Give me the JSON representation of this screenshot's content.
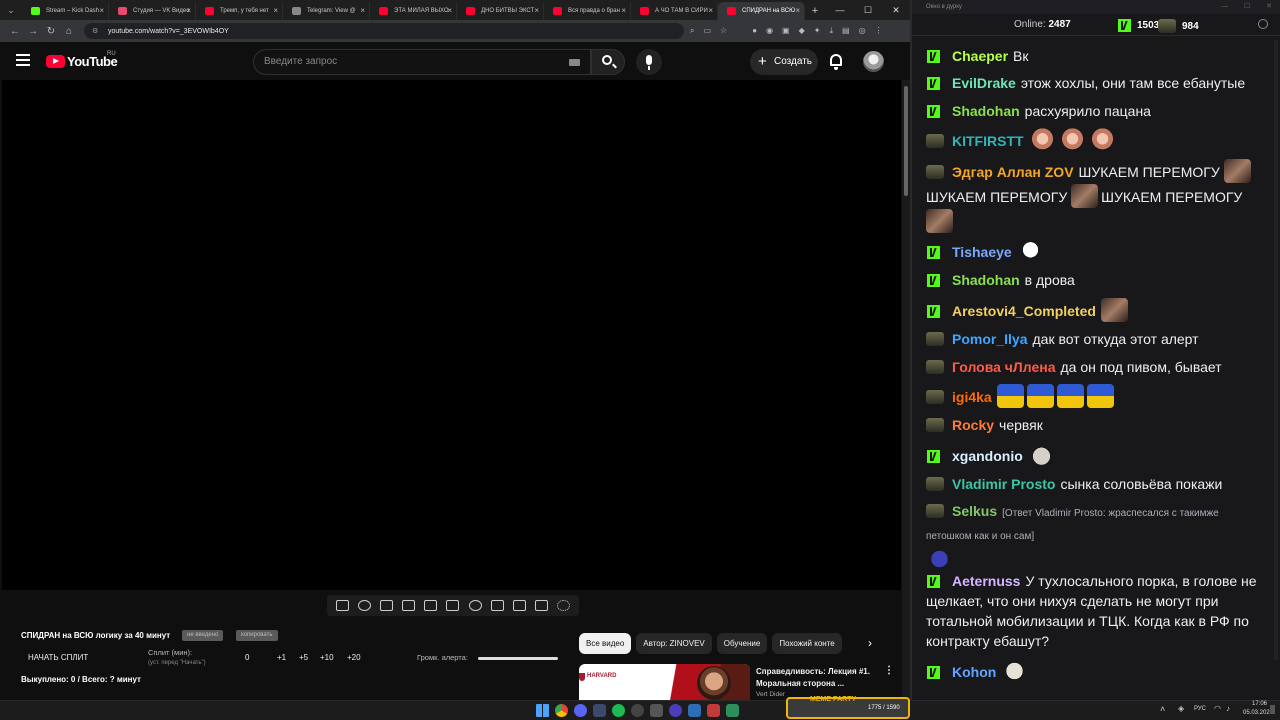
{
  "browser": {
    "tabs": [
      {
        "title": "Stream – Kick Dash",
        "color": "#53fc18",
        "active": false
      },
      {
        "title": "Студия — VK Видео",
        "color": "#e64a6f",
        "active": false
      },
      {
        "title": "Тремп, у тебя нет",
        "color": "#ff0033",
        "active": false
      },
      {
        "title": "Telegram: View @",
        "color": "#888888",
        "active": false
      },
      {
        "title": "ЭТА МИЛАЯ ВЫХО",
        "color": "#ff0033",
        "active": false
      },
      {
        "title": "ДНО БИТВЫ ЭКСТ",
        "color": "#ff0033",
        "active": false
      },
      {
        "title": "Вся правда о бран",
        "color": "#ff0033",
        "active": false
      },
      {
        "title": "А ЧО ТАМ В СИРИ",
        "color": "#ff0033",
        "active": false
      },
      {
        "title": "СПИДРАН на ВСЮ",
        "color": "#ff0033",
        "active": true
      }
    ],
    "url": "youtube.com/watch?v=_3EVOWIb4OY"
  },
  "youtube": {
    "logo_text": "YouTube",
    "logo_region": "RU",
    "search_placeholder": "Введите запрос",
    "create_label": "Создать"
  },
  "panel": {
    "title": "СПИДРАН на ВСЮ логику за 40 минут",
    "chip1": "не введено",
    "chip2": "копировать",
    "start_split": "НАЧАТЬ СПЛИТ",
    "split_label": "Сплит (мин):",
    "split_sub": "(уст. перед \"Начать\")",
    "split_values": [
      "0",
      "+1",
      "+5",
      "+10",
      "+20"
    ],
    "alert_label": "Громк. алерта:",
    "bought": "Выкуплено: 0 / Всего: ? минут"
  },
  "chips": [
    "Все видео",
    "Автор: ZINOVEV",
    "Обучение",
    "Похожий конте"
  ],
  "recommendation": {
    "thumb_text": "HARVARD",
    "title": "Справедливость: Лекция #1. Моральная сторона ...",
    "channel": "Vert Dider"
  },
  "chat": {
    "window_title": "Окно в дурку",
    "online_label": "Online:",
    "online_count": "2487",
    "kick_count": "1503",
    "twitch_count": "984",
    "messages": [
      {
        "platform": "kick",
        "nick": "Chaeper",
        "color": "#b6ff4a",
        "text": "Вк"
      },
      {
        "platform": "kick",
        "nick": "EvilDrake",
        "color": "#6ee7b7",
        "text": "этож хохлы, они там все ебанутые"
      },
      {
        "platform": "kick",
        "nick": "Shadohan",
        "color": "#8be04e",
        "text": "расхуярило пацана"
      },
      {
        "platform": "twitch",
        "nick": "KITFIRSTT",
        "color": "#2fb6b6",
        "text": ""
      },
      {
        "platform": "twitch",
        "nick": "Эдгар Аллан ZOV",
        "color": "#f5a623",
        "text": "ШУКАЕМ ПЕРЕМОГУ"
      },
      {
        "platform": "kick",
        "nick": "Tishaeye",
        "color": "#7aa8ff",
        "text": ""
      },
      {
        "platform": "kick",
        "nick": "Shadohan",
        "color": "#8be04e",
        "text": "в дрова"
      },
      {
        "platform": "kick",
        "nick": "Arestovi4_Completed",
        "color": "#f0d060",
        "text": ""
      },
      {
        "platform": "twitch",
        "nick": "Pomor_Ilya",
        "color": "#3ea6ff",
        "text": "дак вот откуда этот алерт"
      },
      {
        "platform": "twitch",
        "nick": "Голова чЛлена",
        "color": "#ff5a4a",
        "text": "да он под пивом, бывает"
      },
      {
        "platform": "twitch",
        "nick": "igi4ka",
        "color": "#ff6a00",
        "text": ""
      },
      {
        "platform": "twitch",
        "nick": "Rocky",
        "color": "#ff7a3a",
        "text": "червяк"
      },
      {
        "platform": "kick",
        "nick": "xgandonio",
        "color": "#d8f0ff",
        "text": ""
      },
      {
        "platform": "twitch",
        "nick": "Vladimir Prosto",
        "color": "#3fc4a8",
        "text": "сынка соловьёва покажи"
      },
      {
        "platform": "twitch",
        "nick": "Selkus",
        "color": "#86c66a",
        "text": "[Ответ Vladimir Prosto: жраспесался с такимже петошком как и он сам]"
      },
      {
        "platform": "kick",
        "nick": "Aeternuss",
        "color": "#d4b5ff",
        "text": "У тухлосального порка, в голове не щелкает, что они нихуя сделать не могут при тотальной мобилизации и ТЦК. Когда как в РФ по контракту ебашут?"
      },
      {
        "platform": "kick",
        "nick": "Kohon",
        "color": "#60a5ff",
        "text": ""
      }
    ]
  },
  "taskbar": {
    "lang": "РУС",
    "time": "17:06",
    "date": "05.03.2026",
    "meme_label": "MEME PARTY",
    "meme_counts": "1775 / 1590"
  }
}
